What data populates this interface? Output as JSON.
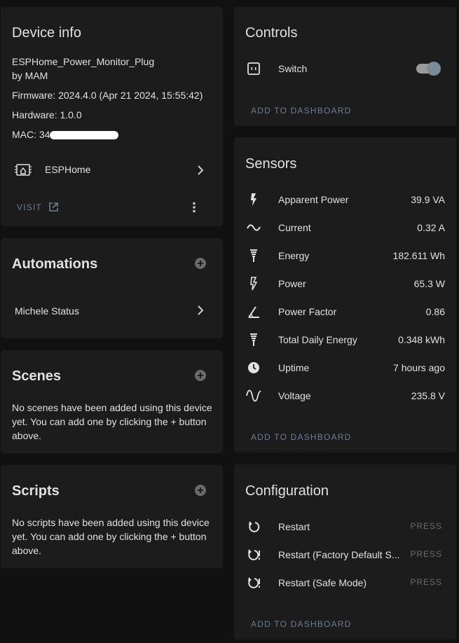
{
  "device_info": {
    "title": "Device info",
    "name_line1": "ESPHome_Power_Monitor_Plug",
    "name_line2": "by MAM",
    "firmware": "Firmware: 2024.4.0 (Apr 21 2024, 15:55:42)",
    "hardware": "Hardware: 1.0.0",
    "mac_label": "MAC: 34",
    "integration_icon": "esphome-chip-icon",
    "integration_label": "ESPHome",
    "visit_label": "VISIT",
    "more_icon": "dots-vertical-icon"
  },
  "automations": {
    "title": "Automations",
    "items": [
      {
        "label": "Michele Status"
      }
    ]
  },
  "scenes": {
    "title": "Scenes",
    "empty_text": "No scenes have been added using this device yet. You can add one by clicking the + button above."
  },
  "scripts": {
    "title": "Scripts",
    "empty_text": "No scripts have been added using this device yet. You can add one by clicking the + button above."
  },
  "controls": {
    "title": "Controls",
    "items": [
      {
        "label": "Switch",
        "icon": "power-socket-icon",
        "state": "on"
      }
    ],
    "add_label": "ADD TO DASHBOARD"
  },
  "sensors": {
    "title": "Sensors",
    "items": [
      {
        "label": "Apparent Power",
        "value": "39.9 VA",
        "icon": "flash-icon"
      },
      {
        "label": "Current",
        "value": "0.32 A",
        "icon": "current-ac-icon"
      },
      {
        "label": "Energy",
        "value": "182.611 Wh",
        "icon": "lightning-bolt-icon"
      },
      {
        "label": "Power",
        "value": "65.3 W",
        "icon": "flash-outline-icon"
      },
      {
        "label": "Power Factor",
        "value": "0.86",
        "icon": "angle-acute-icon"
      },
      {
        "label": "Total Daily Energy",
        "value": "0.348 kWh",
        "icon": "lightning-bolt-icon"
      },
      {
        "label": "Uptime",
        "value": "7 hours ago",
        "icon": "clock-icon"
      },
      {
        "label": "Voltage",
        "value": "235.8 V",
        "icon": "sine-wave-icon"
      }
    ],
    "add_label": "ADD TO DASHBOARD"
  },
  "configuration": {
    "title": "Configuration",
    "items": [
      {
        "label": "Restart",
        "action": "PRESS",
        "icon": "restart-icon"
      },
      {
        "label": "Restart (Factory Default S...",
        "action": "PRESS",
        "icon": "restart-alert-icon"
      },
      {
        "label": "Restart (Safe Mode)",
        "action": "PRESS",
        "icon": "restart-alert-icon"
      }
    ],
    "add_label": "ADD TO DASHBOARD"
  }
}
